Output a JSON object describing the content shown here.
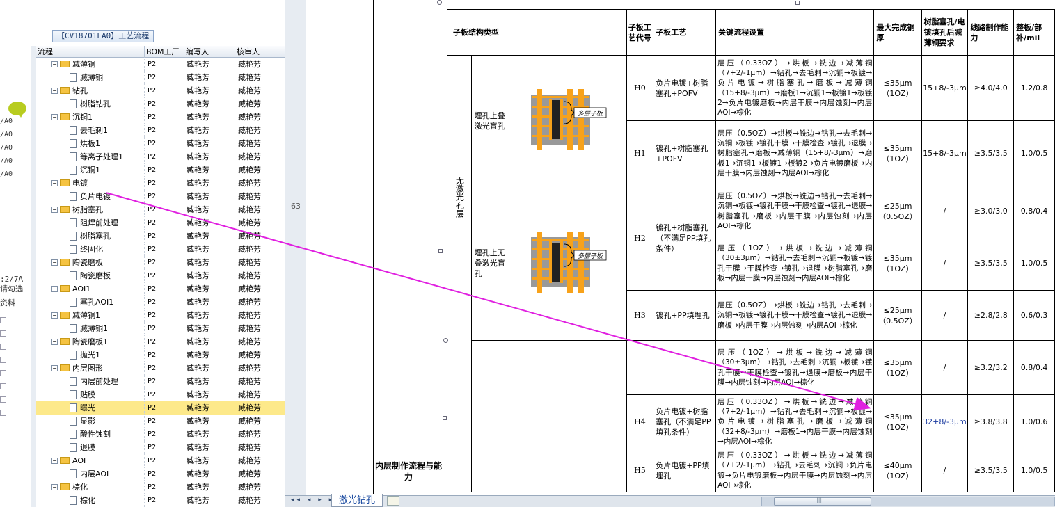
{
  "left_panel": {
    "flow_title": "【CV18701LA0】工艺流程",
    "strip_items": [
      "/A0",
      "/A0",
      "/A0",
      "/A0",
      "/A0"
    ],
    "strip_lower": [
      ":2/7A",
      "请勾选",
      "资料"
    ],
    "columns": [
      "流程",
      "BOM工厂",
      "编写人",
      "核审人"
    ],
    "rows": [
      {
        "level": 1,
        "kind": "folder",
        "name": "减薄铜",
        "bom": "P2",
        "writer": "臧艳芳",
        "reviewer": "臧艳芳"
      },
      {
        "level": 2,
        "kind": "doc",
        "name": "减薄铜",
        "bom": "P2",
        "writer": "臧艳芳",
        "reviewer": "臧艳芳"
      },
      {
        "level": 1,
        "kind": "folder",
        "name": "钻孔",
        "bom": "P2",
        "writer": "臧艳芳",
        "reviewer": "臧艳芳"
      },
      {
        "level": 2,
        "kind": "doc",
        "name": "树脂钻孔",
        "bom": "P2",
        "writer": "臧艳芳",
        "reviewer": "臧艳芳"
      },
      {
        "level": 1,
        "kind": "folder",
        "name": "沉铜1",
        "bom": "P2",
        "writer": "臧艳芳",
        "reviewer": "臧艳芳"
      },
      {
        "level": 2,
        "kind": "doc",
        "name": "去毛刺1",
        "bom": "P2",
        "writer": "臧艳芳",
        "reviewer": "臧艳芳"
      },
      {
        "level": 2,
        "kind": "doc",
        "name": "烘板1",
        "bom": "P2",
        "writer": "臧艳芳",
        "reviewer": "臧艳芳"
      },
      {
        "level": 2,
        "kind": "doc",
        "name": "等离子处理1",
        "bom": "P2",
        "writer": "臧艳芳",
        "reviewer": "臧艳芳"
      },
      {
        "level": 2,
        "kind": "doc",
        "name": "沉铜1",
        "bom": "P2",
        "writer": "臧艳芳",
        "reviewer": "臧艳芳"
      },
      {
        "level": 1,
        "kind": "folder",
        "name": "电镀",
        "bom": "P2",
        "writer": "臧艳芳",
        "reviewer": "臧艳芳"
      },
      {
        "level": 2,
        "kind": "doc",
        "name": "负片电镀",
        "bom": "P2",
        "writer": "臧艳芳",
        "reviewer": "臧艳芳"
      },
      {
        "level": 1,
        "kind": "folder",
        "name": "树脂塞孔",
        "bom": "P2",
        "writer": "臧艳芳",
        "reviewer": "臧艳芳"
      },
      {
        "level": 2,
        "kind": "doc",
        "name": "阻焊前处理",
        "bom": "P2",
        "writer": "臧艳芳",
        "reviewer": "臧艳芳"
      },
      {
        "level": 2,
        "kind": "doc",
        "name": "树脂塞孔",
        "bom": "P2",
        "writer": "臧艳芳",
        "reviewer": "臧艳芳"
      },
      {
        "level": 2,
        "kind": "doc",
        "name": "终固化",
        "bom": "P2",
        "writer": "臧艳芳",
        "reviewer": "臧艳芳"
      },
      {
        "level": 1,
        "kind": "folder",
        "name": "陶瓷磨板",
        "bom": "P2",
        "writer": "臧艳芳",
        "reviewer": "臧艳芳"
      },
      {
        "level": 2,
        "kind": "doc",
        "name": "陶瓷磨板",
        "bom": "P2",
        "writer": "臧艳芳",
        "reviewer": "臧艳芳"
      },
      {
        "level": 1,
        "kind": "folder",
        "name": "AOI1",
        "bom": "P2",
        "writer": "臧艳芳",
        "reviewer": "臧艳芳"
      },
      {
        "level": 2,
        "kind": "doc",
        "name": "塞孔AOI1",
        "bom": "P2",
        "writer": "臧艳芳",
        "reviewer": "臧艳芳"
      },
      {
        "level": 1,
        "kind": "folder",
        "name": "减薄铜1",
        "bom": "P2",
        "writer": "臧艳芳",
        "reviewer": "臧艳芳"
      },
      {
        "level": 2,
        "kind": "doc",
        "name": "减薄铜1",
        "bom": "P2",
        "writer": "臧艳芳",
        "reviewer": "臧艳芳"
      },
      {
        "level": 1,
        "kind": "folder",
        "name": "陶瓷磨板1",
        "bom": "P2",
        "writer": "臧艳芳",
        "reviewer": "臧艳芳"
      },
      {
        "level": 2,
        "kind": "doc",
        "name": "抛光1",
        "bom": "P2",
        "writer": "臧艳芳",
        "reviewer": "臧艳芳"
      },
      {
        "level": 1,
        "kind": "folder",
        "name": "内层图形",
        "bom": "P2",
        "writer": "臧艳芳",
        "reviewer": "臧艳芳"
      },
      {
        "level": 2,
        "kind": "doc",
        "name": "内层前处理",
        "bom": "P2",
        "writer": "臧艳芳",
        "reviewer": "臧艳芳"
      },
      {
        "level": 2,
        "kind": "doc",
        "name": "贴膜",
        "bom": "P2",
        "writer": "臧艳芳",
        "reviewer": "臧艳芳"
      },
      {
        "level": 2,
        "kind": "doc",
        "name": "曝光",
        "bom": "P2",
        "writer": "臧艳芳",
        "reviewer": "臧艳芳",
        "selected": true
      },
      {
        "level": 2,
        "kind": "doc",
        "name": "显影",
        "bom": "P2",
        "writer": "臧艳芳",
        "reviewer": "臧艳芳"
      },
      {
        "level": 2,
        "kind": "doc",
        "name": "酸性蚀刻",
        "bom": "P2",
        "writer": "臧艳芳",
        "reviewer": "臧艳芳"
      },
      {
        "level": 2,
        "kind": "doc",
        "name": "退膜",
        "bom": "P2",
        "writer": "臧艳芳",
        "reviewer": "臧艳芳"
      },
      {
        "level": 1,
        "kind": "folder",
        "name": "AOI",
        "bom": "P2",
        "writer": "臧艳芳",
        "reviewer": "臧艳芳"
      },
      {
        "level": 2,
        "kind": "doc",
        "name": "内层AOI",
        "bom": "P2",
        "writer": "臧艳芳",
        "reviewer": "臧艳芳"
      },
      {
        "level": 1,
        "kind": "folder",
        "name": "棕化",
        "bom": "P2",
        "writer": "臧艳芳",
        "reviewer": "臧艳芳"
      },
      {
        "level": 2,
        "kind": "doc",
        "name": "棕化",
        "bom": "P2",
        "writer": "臧艳芳",
        "reviewer": "臧艳芳"
      }
    ]
  },
  "sheet": {
    "row_number": "63",
    "section_label": "内层制作流程与能力",
    "tab_label": "激光钻孔",
    "header": {
      "type": "子板结构类型",
      "code": "子板工艺代号",
      "process": "子板工艺",
      "flow": "关键流程设置",
      "max_cu": "最大完成铜厚",
      "resin_req": "树脂塞孔/电镀填孔后减薄铜要求",
      "line_cap": "线路制作能力",
      "comp": "整板/部补/mil"
    },
    "group_label": "无激光孔层",
    "sub1": "埋孔上叠激光盲孔",
    "sub2": "埋孔上无叠激光盲孔",
    "diagram_tag": "多层子板",
    "rows": [
      {
        "code": "H0",
        "process": "负片电镀+树脂塞孔+POFV",
        "flow": "层压（0.33OZ）→烘板→铣边→减薄铜（7+2/-1μm）→钻孔→去毛刺→沉铜→板镀→负片电镀→树脂塞孔→磨板→减薄铜（15+8/-3μm）→磨板1→沉铜1→板镀1→板镀2→负片电镀磨板→内层干膜→内层蚀刻→内层AOI→棕化",
        "cu": "≤35μm（1OZ）",
        "resin": "15+8/-3μm",
        "line": "≥4.0/4.0",
        "comp": "1.2/0.8"
      },
      {
        "code": "H1",
        "process": "镀孔+树脂塞孔+POFV",
        "flow": "层压（0.5OZ）→烘板→铣边→钻孔→去毛刺→沉铜→板镀→镀孔干膜→干膜检查→镀孔→退膜→树脂塞孔→磨板→减薄铜（15+8/-3μm）→磨板1→沉铜1→板镀1→板镀2→负片电镀磨板→内层干膜→内层蚀刻→内层AOI→棕化",
        "cu": "≤35μm（1OZ）",
        "resin": "15+8/-3μm",
        "line": "≥3.5/3.5",
        "comp": "1.0/0.5"
      },
      {
        "code": "H2",
        "process": "镀孔+树脂塞孔（不满足PP填孔条件）",
        "flow": "层压（0.5OZ）→烘板→铣边→钻孔→去毛刺→沉铜→板镀→镀孔干膜→干膜检查→镀孔→退膜→树脂塞孔→磨板→内层干膜→内层蚀刻→内层AOI→棕化",
        "cu": "≤25μm（0.5OZ）",
        "resin": "/",
        "line": "≥3.0/3.0",
        "comp": "0.8/0.4"
      },
      {
        "code": "",
        "process": "",
        "flow": "层压（1OZ）→烘板→铣边→减薄铜（30±3μm）→钻孔→去毛刺→沉铜→板镀→镀孔干膜→干膜检查→镀孔→退膜→树脂塞孔→磨板→内层干膜→内层蚀刻→内层AOI→棕化",
        "cu": "≤35μm（1OZ）",
        "resin": "/",
        "line": "≥3.5/3.5",
        "comp": "1.0/0.5"
      },
      {
        "code": "H3",
        "process": "镀孔+PP填埋孔",
        "flow": "层压（0.5OZ）→烘板→铣边→钻孔→去毛刺→沉铜→板镀→镀孔干膜→干膜检查→镀孔→退膜→磨板→内层干膜→内层蚀刻→内层AOI→棕化",
        "cu": "≤25μm（0.5OZ）",
        "resin": "/",
        "line": "≥2.8/2.8",
        "comp": "0.6/0.3"
      },
      {
        "code": "",
        "process": "",
        "flow": "层压（1OZ）→烘板→铣边→减薄铜（30±3μm）→钻孔→去毛刺→沉铜→板镀→镀孔干膜→干膜检查→镀孔→退膜→磨板→内层干膜→内层蚀刻→内层AOI→棕化",
        "cu": "≤35μm（1OZ）",
        "resin": "/",
        "line": "≥3.2/3.2",
        "comp": "0.8/0.4"
      },
      {
        "code": "H4",
        "process": "负片电镀+树脂塞孔（不满足PP填孔条件）",
        "flow": "层压（0.33OZ）→烘板→铣边→减薄铜（7+2/-1μm）→钻孔→去毛刺→沉铜→板镀→负片电镀→树脂塞孔→磨板→减薄铜（32+8/-3μm）→磨板1→内层干膜→内层蚀刻→内层AOI→棕化",
        "cu": "≤35μm（1OZ）",
        "resin": "32+8/-3μm",
        "line": "≥3.8/3.8",
        "comp": "1.0/0.6"
      },
      {
        "code": "H5",
        "process": "负片电镀+PP填埋孔",
        "flow": "层压（0.33OZ）→烘板→铣边→减薄铜（7+2/-1μm）→钻孔→去毛刺→沉铜→负片电镀→负片电镀磨板→内层干膜→内层蚀刻→内层AOI→棕化",
        "cu": "≤40μm（1OZ）",
        "resin": "/",
        "line": "≥3.5/3.5",
        "comp": "1.0/0.5"
      }
    ]
  },
  "colors": {
    "folder": "#f5c342",
    "selected_row": "#fde98a",
    "arrow": "#e020e0",
    "diagram_copper": "#f7a21b",
    "diagram_core": "#999999"
  }
}
